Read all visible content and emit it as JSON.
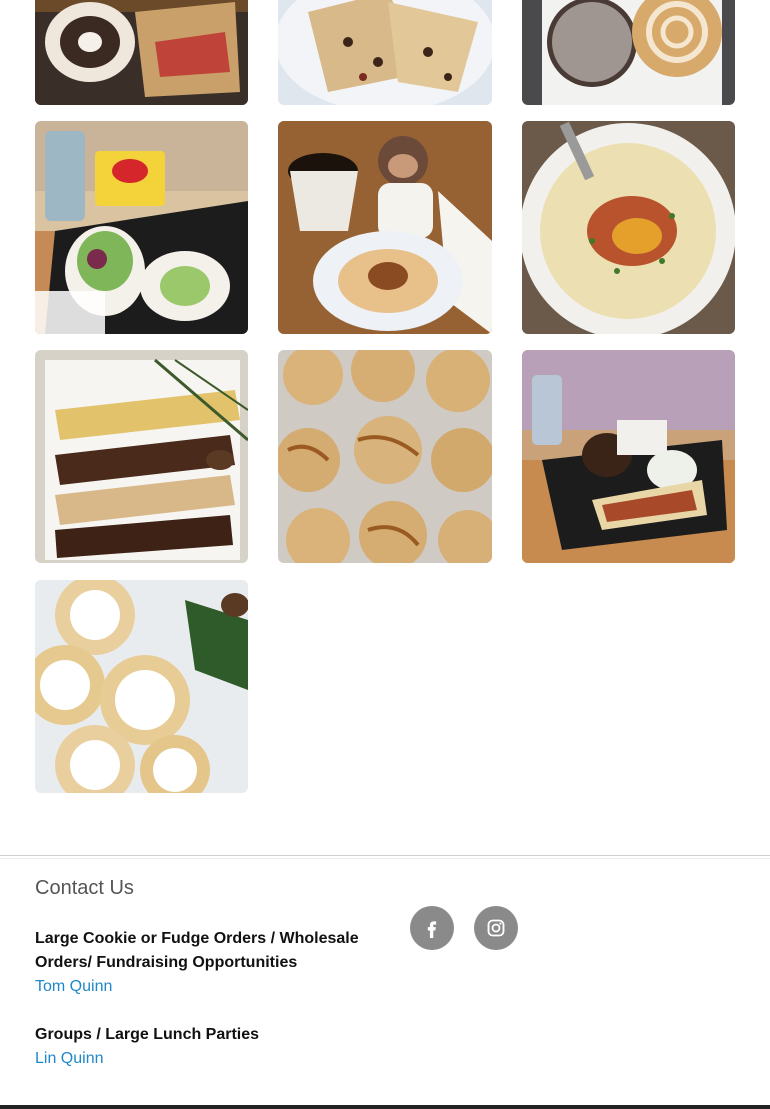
{
  "gallery": {
    "photos": [
      {
        "name": "photo-panini-donut",
        "subject": "panini sandwich with donut in basket"
      },
      {
        "name": "photo-scone",
        "subject": "chocolate chip scone slices on plate"
      },
      {
        "name": "photo-cookies-napkin",
        "subject": "cookies on napkin"
      },
      {
        "name": "photo-wraps-chips",
        "subject": "wraps with chips and soda in basket"
      },
      {
        "name": "photo-coffee-monkey",
        "subject": "coffee, toy monkey and pastry"
      },
      {
        "name": "photo-potato-soup",
        "subject": "loaded potato soup"
      },
      {
        "name": "photo-biscotti",
        "subject": "drizzled biscotti on plate"
      },
      {
        "name": "photo-caramel-cookies",
        "subject": "caramel drizzled cookies on tray"
      },
      {
        "name": "photo-quesadilla-basket",
        "subject": "quesadilla with cookie and soda"
      },
      {
        "name": "photo-snowman-cookies",
        "subject": "melting snowman cookies"
      }
    ]
  },
  "contact": {
    "title": "Contact Us",
    "blocks": [
      {
        "heading": "Large Cookie or Fudge Orders / Wholesale Orders/ Fundraising Opportunities",
        "link": "Tom Quinn"
      },
      {
        "heading": "Groups / Large Lunch Parties",
        "link": "Lin Quinn"
      }
    ]
  },
  "social": [
    {
      "icon": "facebook-icon"
    },
    {
      "icon": "instagram-icon"
    }
  ],
  "colors": {
    "link": "#1e88c8",
    "social_bg": "#8a8a8a",
    "heading": "#111111"
  }
}
